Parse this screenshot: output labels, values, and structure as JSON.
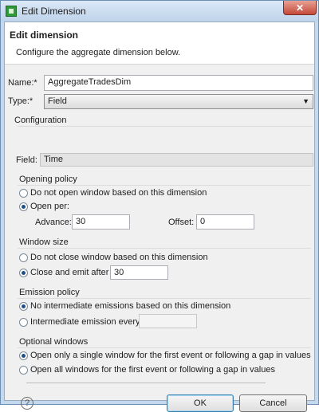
{
  "window": {
    "title": "Edit Dimension",
    "close_glyph": "✕"
  },
  "header": {
    "title": "Edit dimension",
    "description": "Configure the aggregate dimension below."
  },
  "form": {
    "name_label": "Name:*",
    "name_value": "AggregateTradesDim",
    "type_label": "Type:*",
    "type_value": "Field",
    "configuration_label": "Configuration",
    "field_label": "Field:",
    "field_value": "Time"
  },
  "opening_policy": {
    "title": "Opening policy",
    "option_no_open": "Do not open window based on this dimension",
    "option_open_per": "Open per:",
    "selected": "open_per",
    "advance_label": "Advance:",
    "advance_value": "30",
    "offset_label": "Offset:",
    "offset_value": "0"
  },
  "window_size": {
    "title": "Window size",
    "option_no_close": "Do not close window based on this dimension",
    "option_close_emit": "Close and emit after",
    "close_emit_value": "30",
    "selected": "close_emit"
  },
  "emission_policy": {
    "title": "Emission policy",
    "option_no_intermediate": "No intermediate emissions based on this dimension",
    "option_intermediate": "Intermediate emission every",
    "intermediate_value": "",
    "selected": "no_intermediate"
  },
  "optional_windows": {
    "title": "Optional windows",
    "option_single": "Open only a single window for the first event or following a gap in values",
    "option_all": "Open all windows for the first event or following a gap in values",
    "selected": "single"
  },
  "footer": {
    "help_glyph": "?",
    "ok_label": "OK",
    "cancel_label": "Cancel"
  },
  "icons": {
    "app": "app-icon",
    "help": "help-icon",
    "combo_arrow": "chevron-down-icon"
  }
}
